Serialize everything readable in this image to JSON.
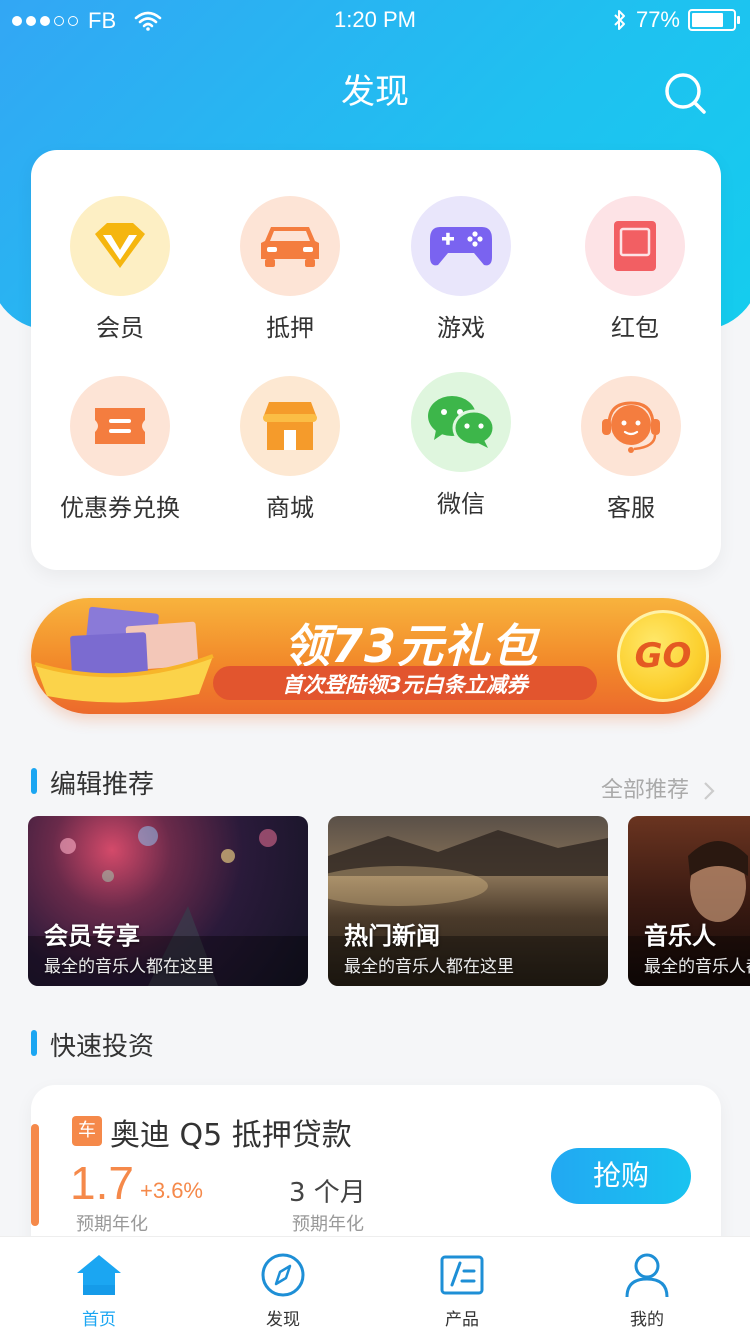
{
  "status_bar": {
    "carrier": "FB",
    "time": "1:20 PM",
    "battery": "77%",
    "battery_level": 0.77
  },
  "nav": {
    "title": "发现"
  },
  "grid": [
    {
      "label": "会员",
      "icon": "vip-diamond-icon",
      "bg": "#fdefc4"
    },
    {
      "label": "抵押",
      "icon": "car-icon",
      "bg": "#fde4d6"
    },
    {
      "label": "游戏",
      "icon": "gamepad-icon",
      "bg": "#e9e6fb"
    },
    {
      "label": "红包",
      "icon": "red-envelope-icon",
      "bg": "#fde3e6"
    },
    {
      "label": "优惠券兑换",
      "icon": "coupon-icon",
      "bg": "#fde4d6"
    },
    {
      "label": "商城",
      "icon": "shop-icon",
      "bg": "#fde8d2"
    },
    {
      "label": "微信",
      "icon": "wechat-icon",
      "bg": "#dff6de"
    },
    {
      "label": "客服",
      "icon": "customer-service-icon",
      "bg": "#fde4d6"
    }
  ],
  "banner": {
    "title": "领73元礼包",
    "subtitle": "首次登陆领3元白条立减券",
    "go": "GO"
  },
  "editor_picks": {
    "title": "编辑推荐",
    "more": "全部推荐",
    "items": [
      {
        "title": "会员专享",
        "subtitle": "最全的音乐人都在这里"
      },
      {
        "title": "热门新闻",
        "subtitle": "最全的音乐人都在这里"
      },
      {
        "title": "音乐人",
        "subtitle": "最全的音乐人都在这里"
      }
    ]
  },
  "quick_invest": {
    "title": "快速投资",
    "product": {
      "tag": "车",
      "name": "奥迪 Q5 抵押贷款",
      "rate": "1.7",
      "rate_plus": "+3.6%",
      "rate_label": "预期年化",
      "term": "3 个月",
      "term_label": "预期年化",
      "buy": "抢购"
    }
  },
  "tabbar": [
    {
      "label": "首页",
      "icon": "home-icon",
      "active": true
    },
    {
      "label": "发现",
      "icon": "compass-icon",
      "active": false
    },
    {
      "label": "产品",
      "icon": "product-icon",
      "active": false
    },
    {
      "label": "我的",
      "icon": "profile-icon",
      "active": false
    }
  ],
  "colors": {
    "primary": "#1ba6f2",
    "accent": "#f5894a",
    "banner": "#f28a2a"
  }
}
